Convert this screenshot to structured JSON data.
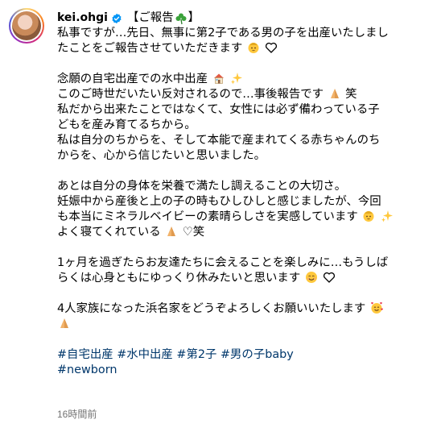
{
  "post": {
    "username": "kei.ohgi",
    "title": "【ご報告",
    "title_end": "】",
    "lines": {
      "l1": "私事ですが…先日、無事に第2子である男の子を出産いたしまし",
      "l2": "たことをご報告させていただきます",
      "l3": "念願の自宅出産での水中出産",
      "l4a": "このご時世だいたい反対されるので…事後報告です",
      "l4b": "笑",
      "l5": "私だから出来たことではなくて、女性には必ず備わっている子",
      "l6": "どもを産み育てるちから。",
      "l7": "私は自分のちからを、そして本能で産まれてくる赤ちゃんのち",
      "l8": "からを、心から信じたいと思いました。",
      "l9": "あとは自分の身体を栄養で満たし調えることの大切さ。",
      "l10": "妊娠中から産後と上の子の時もひしひしと感じましたが、今回",
      "l11": "も本当にミネラルベイビーの素晴らしさを実感しています",
      "l12a": "よく寝てくれている",
      "l12b": "♡笑",
      "l13": "1ヶ月を過ぎたらお友達たちに会えることを楽しみに…もうしば",
      "l14": "らくは心身ともにゆっくり休みたいと思います",
      "l15": "4人家族になった浜名家をどうぞよろしくお願いいたします"
    },
    "hashtags": [
      "#自宅出産",
      "#水中出産",
      "#第2子",
      "#男の子baby",
      "#newborn"
    ],
    "timestamp": "16時間前"
  },
  "icons": [
    "avatar",
    "verified-badge-icon",
    "shamrock-emoji",
    "baby-emoji",
    "heart-emoji",
    "house-emoji",
    "sparkles-emoji",
    "praying-hands-emoji",
    "smiling-face-emoji",
    "smiling-face-hearts-emoji"
  ],
  "colors": {
    "hashtag": "#00376b",
    "verified": "#0095f6",
    "timestamp": "#737373"
  }
}
